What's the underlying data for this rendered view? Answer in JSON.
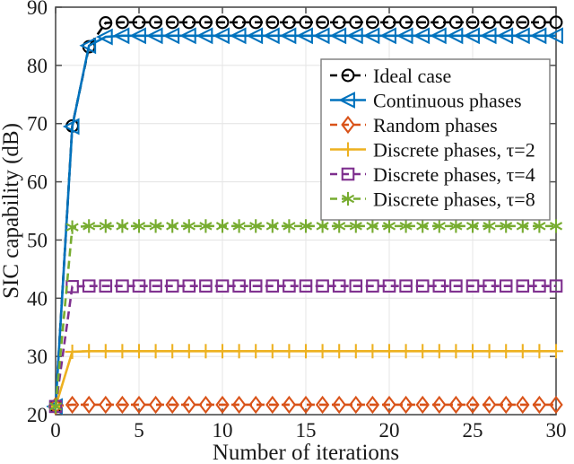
{
  "chart_data": {
    "type": "line",
    "title": "",
    "xlabel": "Number of iterations",
    "ylabel": "SIC capability (dB)",
    "xlim": [
      0,
      30
    ],
    "ylim": [
      20,
      90
    ],
    "xticks": [
      0,
      5,
      10,
      15,
      20,
      25,
      30
    ],
    "yticks": [
      20,
      30,
      40,
      50,
      60,
      70,
      80,
      90
    ],
    "xtick_labels": [
      "0",
      "5",
      "10",
      "15",
      "20",
      "25",
      "30"
    ],
    "ytick_labels": [
      "20",
      "30",
      "40",
      "50",
      "60",
      "70",
      "80",
      "90"
    ],
    "grid": true,
    "legend_position": "upper right",
    "x": [
      0,
      1,
      2,
      3,
      4,
      5,
      6,
      7,
      8,
      9,
      10,
      11,
      12,
      13,
      14,
      15,
      16,
      17,
      18,
      19,
      20,
      21,
      22,
      23,
      24,
      25,
      26,
      27,
      28,
      29,
      30
    ],
    "series": [
      {
        "name": "Ideal case",
        "color": "#000000",
        "marker": "circle",
        "linestyle": "dashed",
        "values": [
          21.4,
          69.6,
          83.2,
          87.3,
          87.4,
          87.4,
          87.4,
          87.4,
          87.4,
          87.4,
          87.4,
          87.4,
          87.4,
          87.4,
          87.4,
          87.4,
          87.4,
          87.4,
          87.4,
          87.4,
          87.4,
          87.4,
          87.4,
          87.4,
          87.4,
          87.4,
          87.4,
          87.4,
          87.4,
          87.4,
          87.4
        ]
      },
      {
        "name": "Continuous phases",
        "color": "#0072BD",
        "marker": "triangle-left",
        "linestyle": "solid",
        "values": [
          21.4,
          69.5,
          83.4,
          84.9,
          85.1,
          85.1,
          85.1,
          85.1,
          85.1,
          85.1,
          85.1,
          85.1,
          85.1,
          85.1,
          85.1,
          85.1,
          85.1,
          85.1,
          85.1,
          85.1,
          85.1,
          85.1,
          85.1,
          85.1,
          85.1,
          85.1,
          85.1,
          85.1,
          85.1,
          85.1,
          85.1
        ]
      },
      {
        "name": "Random phases",
        "color": "#D95319",
        "marker": "diamond",
        "linestyle": "dashed",
        "values": [
          21.5,
          21.7,
          21.7,
          21.7,
          21.7,
          21.7,
          21.7,
          21.7,
          21.7,
          21.7,
          21.7,
          21.7,
          21.7,
          21.7,
          21.7,
          21.7,
          21.7,
          21.7,
          21.7,
          21.7,
          21.7,
          21.7,
          21.7,
          21.7,
          21.7,
          21.7,
          21.7,
          21.7,
          21.7,
          21.7,
          21.7
        ]
      },
      {
        "name": "Discrete phases, τ=2",
        "color": "#EDB120",
        "marker": "plus",
        "linestyle": "solid",
        "values": [
          21.4,
          30.8,
          30.9,
          30.9,
          30.9,
          30.9,
          30.9,
          30.9,
          30.9,
          30.9,
          30.9,
          30.9,
          30.9,
          30.9,
          30.9,
          30.9,
          30.9,
          30.9,
          30.9,
          30.9,
          30.9,
          30.9,
          30.9,
          30.9,
          30.9,
          30.9,
          30.9,
          30.9,
          30.9,
          30.9,
          30.9
        ]
      },
      {
        "name": "Discrete phases, τ=4",
        "color": "#7E2F8E",
        "marker": "square",
        "linestyle": "dashed",
        "values": [
          21.4,
          42.0,
          42.1,
          42.1,
          42.1,
          42.1,
          42.1,
          42.1,
          42.1,
          42.1,
          42.1,
          42.1,
          42.1,
          42.1,
          42.1,
          42.1,
          42.1,
          42.1,
          42.1,
          42.1,
          42.1,
          42.1,
          42.1,
          42.1,
          42.1,
          42.1,
          42.1,
          42.1,
          42.1,
          42.1,
          42.1
        ]
      },
      {
        "name": "Discrete phases, τ=8",
        "color": "#77AC30",
        "marker": "asterisk",
        "linestyle": "dashed",
        "values": [
          21.4,
          52.2,
          52.4,
          52.4,
          52.4,
          52.4,
          52.4,
          52.4,
          52.4,
          52.4,
          52.4,
          52.4,
          52.4,
          52.4,
          52.4,
          52.4,
          52.4,
          52.4,
          52.4,
          52.4,
          52.4,
          52.4,
          52.4,
          52.4,
          52.4,
          52.4,
          52.4,
          52.4,
          52.4,
          52.4,
          52.4
        ]
      }
    ]
  },
  "legend": {
    "entries": [
      {
        "label": "Ideal case"
      },
      {
        "label": "Continuous phases"
      },
      {
        "label": "Random phases"
      },
      {
        "label": "Discrete phases, τ=2"
      },
      {
        "label": "Discrete phases, τ=4"
      },
      {
        "label": "Discrete phases, τ=8"
      }
    ]
  }
}
